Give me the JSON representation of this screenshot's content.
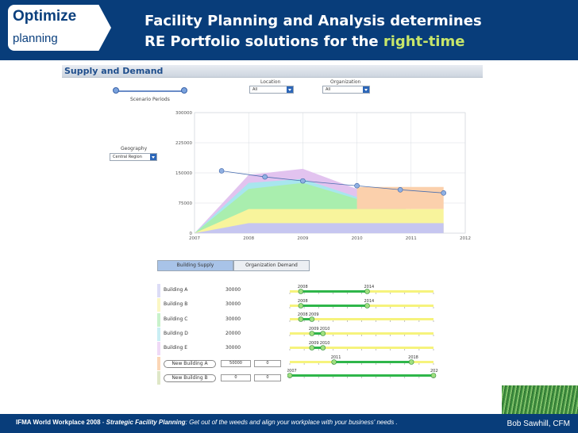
{
  "header": {
    "badge_top": "Optimize",
    "badge_bottom": "planning",
    "title_line1": "Facility Planning and Analysis determines",
    "title_line2_prefix": "RE Portfolio solutions for the ",
    "title_line2_accent": "right-time"
  },
  "panel": {
    "title": "Supply and Demand",
    "scenario_label": "Scenario Periods",
    "location_label": "Location",
    "location_value": "All",
    "organization_label": "Organization",
    "organization_value": "All",
    "geography_label": "Geography",
    "geography_value": "Central Region"
  },
  "chart_data": {
    "type": "area",
    "title": "",
    "xlabel": "",
    "ylabel": "",
    "x": [
      2007,
      2008,
      2009,
      2010,
      2011,
      2012
    ],
    "y_ticks": [
      "300000",
      "225000",
      "150000",
      "75000",
      "0"
    ],
    "ylim": [
      0,
      300000
    ],
    "stacked_series": [
      {
        "color": "#c6c6f0",
        "points": [
          [
            2007,
            0
          ],
          [
            2008,
            25000
          ],
          [
            2011.6,
            25000
          ]
        ]
      },
      {
        "color": "#f8f49c",
        "points": [
          [
            2007,
            0
          ],
          [
            2008,
            60000
          ],
          [
            2011.6,
            60000
          ]
        ]
      },
      {
        "color": "#a9eeae",
        "points": [
          [
            2007,
            0
          ],
          [
            2008,
            110000
          ],
          [
            2009,
            125000
          ],
          [
            2010,
            85000
          ],
          [
            2010.9,
            60000
          ]
        ]
      },
      {
        "color": "#a8e6ee",
        "points": [
          [
            2007,
            0
          ],
          [
            2008,
            125000
          ],
          [
            2009,
            135000
          ],
          [
            2010,
            90000
          ],
          [
            2010.9,
            60000
          ]
        ]
      },
      {
        "color": "#e2c3ef",
        "points": [
          [
            2007,
            0
          ],
          [
            2008,
            145000
          ],
          [
            2009,
            160000
          ],
          [
            2010,
            110000
          ],
          [
            2010.9,
            60000
          ]
        ]
      },
      {
        "color": "#fbd0ac",
        "points": [
          [
            2010,
            60000
          ],
          [
            2010,
            115000
          ],
          [
            2011.6,
            115000
          ],
          [
            2011.6,
            60000
          ]
        ]
      }
    ],
    "line_series": {
      "color": "#4a6fb0",
      "points": [
        [
          2007.5,
          155000
        ],
        [
          2008.3,
          140000
        ],
        [
          2009,
          130000
        ],
        [
          2010,
          118000
        ],
        [
          2010.8,
          108000
        ],
        [
          2011.6,
          100000
        ]
      ]
    },
    "grid": true
  },
  "tabs": [
    {
      "label": "Building Supply",
      "active": true
    },
    {
      "label": "Organization Demand",
      "active": false
    }
  ],
  "buildings": [
    {
      "name": "Building A",
      "value": "30000",
      "color": "#dcdcf6"
    },
    {
      "name": "Building B",
      "value": "30000",
      "color": "#fbf7c4"
    },
    {
      "name": "Building C",
      "value": "30000",
      "color": "#c8f2cb"
    },
    {
      "name": "Building D",
      "value": "20000",
      "color": "#c9eef4"
    },
    {
      "name": "Building E",
      "value": "30000",
      "color": "#efd9f6"
    }
  ],
  "new_buildings": [
    {
      "name": "New Building A",
      "value1": "50000",
      "value2": "0",
      "color": "#fbd6b6"
    },
    {
      "name": "New Building B",
      "value1": "0",
      "value2": "0",
      "color": "#dfe7c7"
    }
  ],
  "gantt": [
    {
      "start": "2008",
      "end": "2014"
    },
    {
      "start": "2008",
      "end": "2014"
    },
    {
      "start": "2008",
      "end": "2009"
    },
    {
      "start": "2009",
      "end": "2010"
    },
    {
      "start": "2009",
      "end": "2010"
    },
    {
      "start": "2011",
      "end": "2018"
    },
    {
      "start": "2007",
      "end": "2020"
    }
  ],
  "footer": {
    "org": "IFMA World Workplace 2008",
    "sep": " - ",
    "session_title": "Strategic Facility Planning",
    "session_rest": ": Get out of the weeds and align your workplace with your business' needs .",
    "author": "Bob Sawhill, CFM"
  },
  "colors": {
    "brand_blue": "#083d7a",
    "accent_green": "#c7e66a",
    "gantt_green": "#2fb64a",
    "gantt_yellow": "#f6f37c"
  }
}
